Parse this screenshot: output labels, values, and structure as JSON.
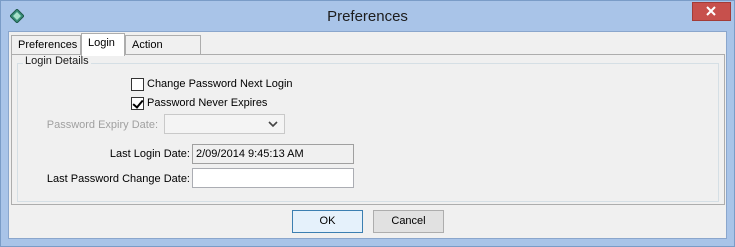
{
  "window": {
    "title": "Preferences"
  },
  "tabs": [
    {
      "label": "Preferences"
    },
    {
      "label": "Login"
    },
    {
      "label": "Action Centre"
    }
  ],
  "login_details": {
    "group_label": "Login Details",
    "change_password_next_login": {
      "label": "Change Password Next Login",
      "checked": false
    },
    "password_never_expires": {
      "label": "Password Never Expires",
      "checked": true
    },
    "password_expiry_date": {
      "label": "Password Expiry Date:",
      "value": ""
    },
    "last_login_date": {
      "label": "Last Login Date:",
      "value": "2/09/2014 9:45:13 AM"
    },
    "last_password_change_date": {
      "label": "Last Password Change Date:",
      "value": ""
    }
  },
  "buttons": {
    "ok": "OK",
    "cancel": "Cancel"
  }
}
